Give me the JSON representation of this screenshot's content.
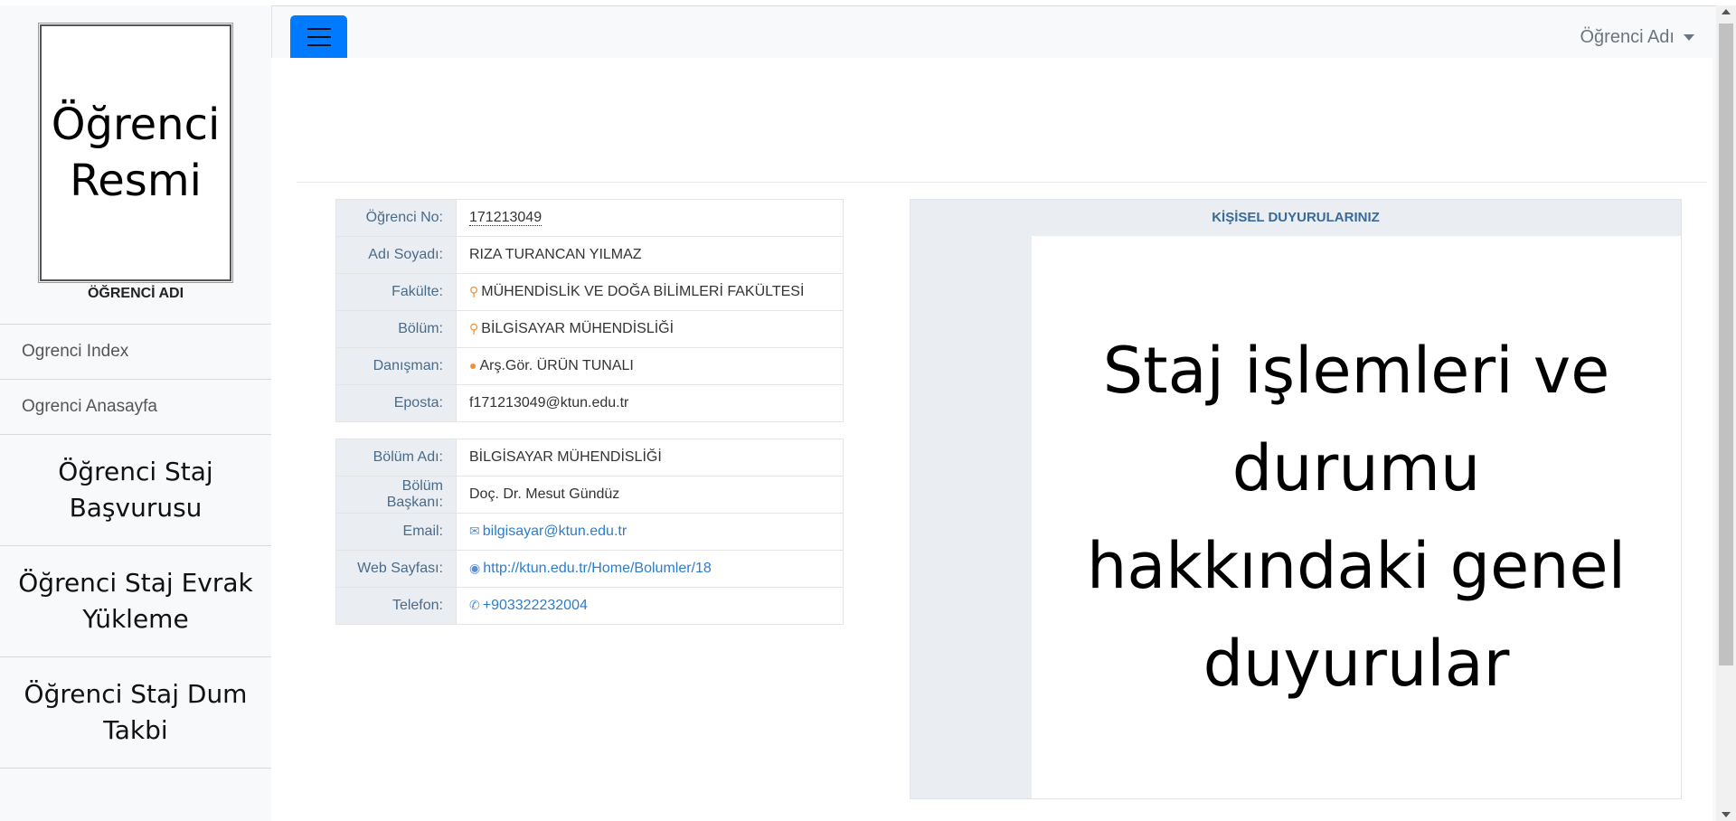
{
  "sidebar": {
    "photo_text": "Öğrenci Resmi",
    "student_name": "ÖĞRENCİ ADI",
    "items": [
      {
        "label": "Ogrenci Index"
      },
      {
        "label": "Ogrenci Anasayfa"
      },
      {
        "label": "Öğrenci Staj Başvurusu"
      },
      {
        "label": "Öğrenci Staj Evrak Yükleme"
      },
      {
        "label": "Öğrenci Staj Dum Takbi"
      }
    ]
  },
  "topbar": {
    "menu_icon": "hamburger-icon",
    "user_label": "Öğrenci Adı",
    "accent_color": "#007bff"
  },
  "student_info": [
    {
      "label": "Öğrenci No:",
      "value": "171213049"
    },
    {
      "label": "Adı Soyadı:",
      "value": "RIZA TURANCAN YILMAZ"
    },
    {
      "label": "Fakülte:",
      "value": "MÜHENDİSLİK VE DOĞA BİLİMLERİ FAKÜLTESİ",
      "icon": "map-marker-icon"
    },
    {
      "label": "Bölüm:",
      "value": "BİLGİSAYAR MÜHENDİSLİĞİ",
      "icon": "map-marker-icon"
    },
    {
      "label": "Danışman:",
      "value": "Arş.Gör. ÜRÜN TUNALI",
      "icon": "user-icon"
    },
    {
      "label": "Eposta:",
      "value": "f171213049@ktun.edu.tr"
    }
  ],
  "department_info": [
    {
      "label": "Bölüm Adı:",
      "value": "BİLGİSAYAR MÜHENDİSLİĞİ"
    },
    {
      "label": "Bölüm Başkanı:",
      "value": "Doç. Dr. Mesut Gündüz"
    },
    {
      "label": "Email:",
      "value": "bilgisayar@ktun.edu.tr",
      "icon": "envelope-icon"
    },
    {
      "label": "Web Sayfası:",
      "value": "http://ktun.edu.tr/Home/Bolumler/18",
      "icon": "globe-icon"
    },
    {
      "label": "Telefon:",
      "value": "+903322232004",
      "icon": "phone-icon"
    }
  ],
  "announcements": {
    "header": "KİŞİSEL DUYURULARINIZ",
    "body": "Staj işlemleri ve durumu hakkındaki genel duyurular"
  }
}
